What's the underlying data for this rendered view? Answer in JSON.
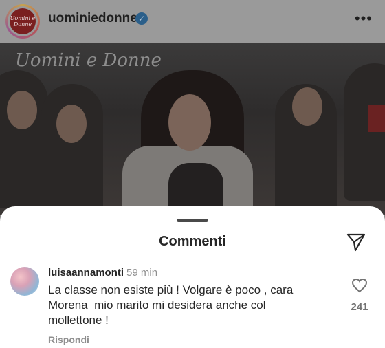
{
  "header": {
    "avatar_logo": "Uomini e Donne",
    "username": "uominiedonne",
    "verified_icon": "verified-badge-icon",
    "more_icon": "more-dots-icon",
    "more_glyph": "•••"
  },
  "post": {
    "logo_text": "Uomini e Donne"
  },
  "comments_sheet": {
    "title": "Commenti",
    "send_icon": "send-icon",
    "comment": {
      "username": "luisaannamonti",
      "time": "59 min",
      "text": "La classe non esiste più ! Volgare è poco , cara\nMorena  mio marito mi desidera anche col\nmollettone !",
      "reply_label": "Rispondi",
      "like_icon": "heart-icon",
      "like_count": "241"
    }
  },
  "colors": {
    "sheet_bg": "#ffffff",
    "text": "#262626",
    "muted": "#8e8e8e",
    "verified": "#0095f6"
  }
}
